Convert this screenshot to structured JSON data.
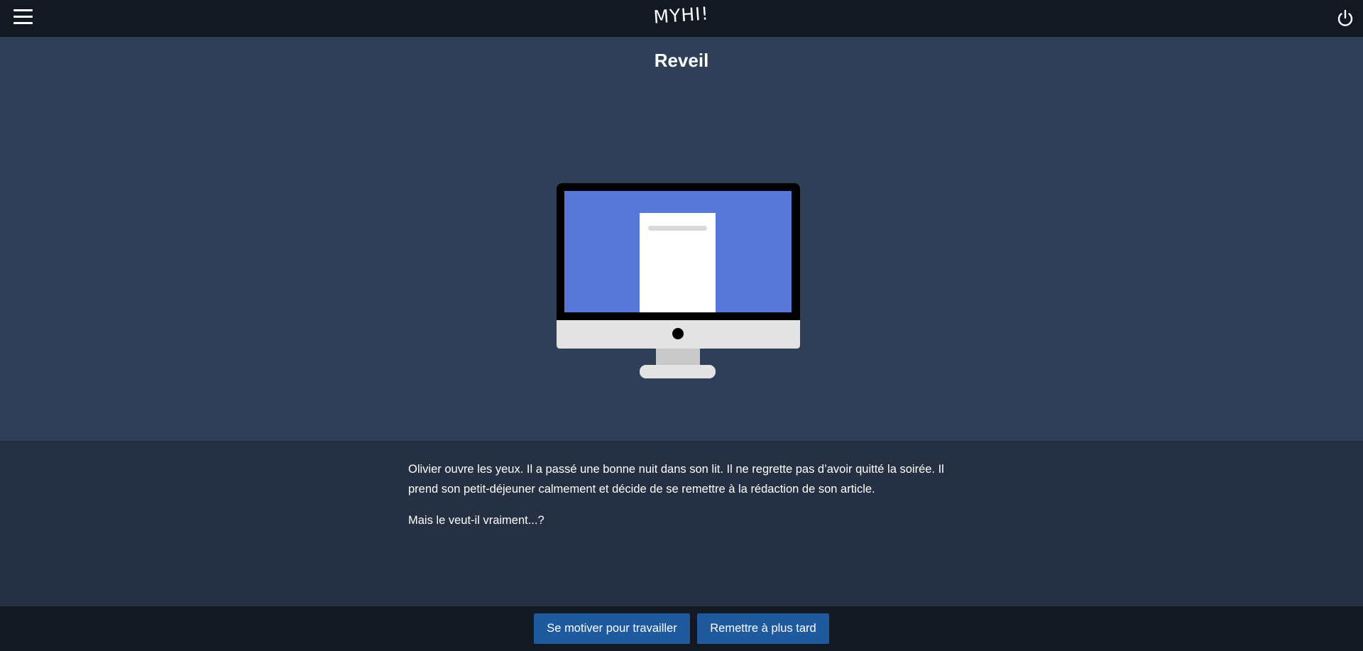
{
  "header": {
    "logo": "MYHI!",
    "menu_icon": "hamburger-menu-icon",
    "power_icon": "power-icon"
  },
  "scene": {
    "title": "Reveil",
    "illustration": "desktop-computer-with-document"
  },
  "story": {
    "paragraphs": [
      "Olivier ouvre les yeux. Il a passé une bonne nuit dans son lit. Il ne regrette pas d’avoir quitté la soirée. Il prend son petit-déjeuner calmement et décide de se remettre à la rédaction de son article.",
      "Mais le veut-il vraiment...?"
    ]
  },
  "choices": [
    {
      "label": "Se motiver pour travailler"
    },
    {
      "label": "Remettre à plus tard"
    }
  ],
  "colors": {
    "topbar": "#121923",
    "hero_bg": "#2e3f57",
    "story_bg": "#253142",
    "button": "#1f5a9f",
    "screen_blue": "#5778d6"
  }
}
